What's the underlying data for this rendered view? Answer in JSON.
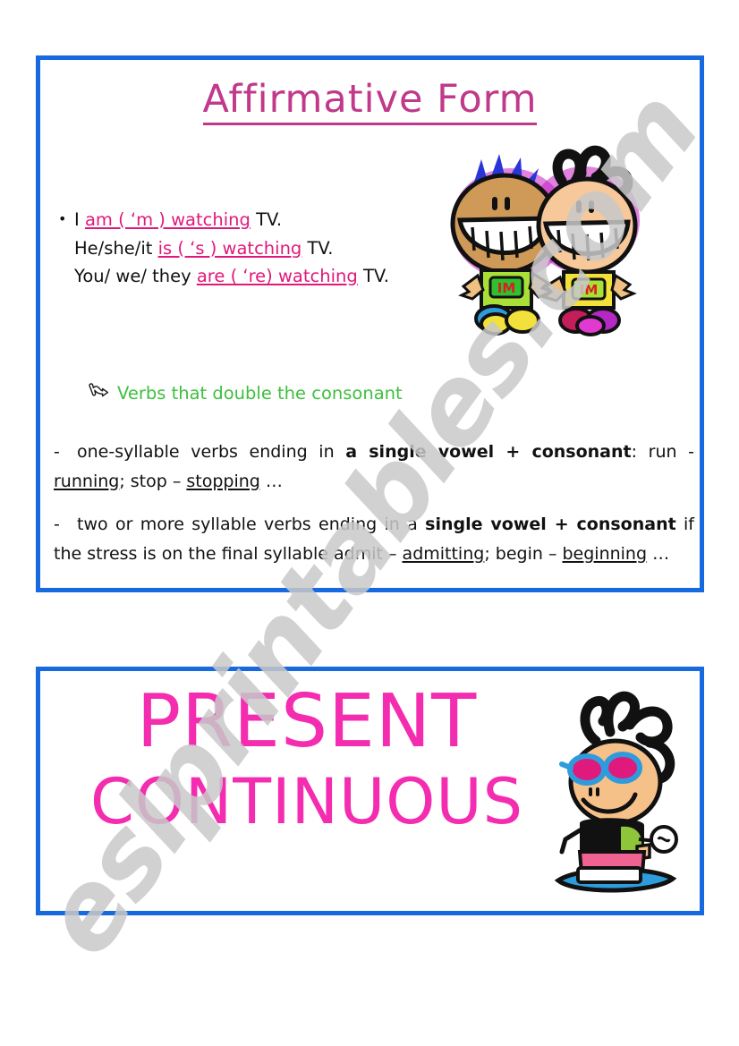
{
  "colors": {
    "border_blue": "#1769e0",
    "title_pink": "#c0398a",
    "highlight_pink": "#e0197c",
    "banner_pink": "#f42cb0",
    "green": "#3fbf3f",
    "text_black": "#111111",
    "watermark_gray": "#c9c9c9"
  },
  "watermark": {
    "text": "eslprintables.com"
  },
  "top_box": {
    "title": "Affirmative Form",
    "bullet_glyph": "•",
    "examples": [
      {
        "pre": "I ",
        "highlight": "am ( ‘m ) watching",
        "post": " TV."
      },
      {
        "pre": "He/she/it  ",
        "highlight": "is ( ‘s ) watching",
        "post": " TV."
      },
      {
        "pre": "You/ we/ they ",
        "highlight": "are ( ‘re) watching",
        "post": " TV."
      }
    ],
    "section_icon": "pointing-hand",
    "section_heading": "Verbs that double the consonant",
    "rules": [
      {
        "dash": "-",
        "parts": [
          {
            "text": "one-syllable verbs ending in ",
            "style": "normal"
          },
          {
            "text": "a single vowel + consonant",
            "style": "bold"
          },
          {
            "text": ": run - ",
            "style": "normal"
          },
          {
            "text": "running",
            "style": "underline"
          },
          {
            "text": "; stop – ",
            "style": "normal"
          },
          {
            "text": "stopping",
            "style": "underline"
          },
          {
            "text": " …",
            "style": "normal"
          }
        ]
      },
      {
        "dash": "-",
        "parts": [
          {
            "text": "two or more syllable verbs ending in a ",
            "style": "normal"
          },
          {
            "text": "single vowel + consonant",
            "style": "bold"
          },
          {
            "text": " if the stress is on the final syllable admit – ",
            "style": "normal"
          },
          {
            "text": "admitting",
            "style": "underline"
          },
          {
            "text": "; begin – ",
            "style": "normal"
          },
          {
            "text": "beginning",
            "style": "underline"
          },
          {
            "text": " …",
            "style": "normal"
          }
        ]
      }
    ],
    "illustration": {
      "name": "two-smiling-kids-clipart",
      "shirt_label": "IM",
      "kid_left": {
        "hair_color": "#2a35d8",
        "face_color": "#cf9a58",
        "shirt_color": "#a8e038"
      },
      "kid_right": {
        "hair_color": "#111111",
        "face_color": "#f6c89a",
        "shirt_color": "#f2e13a"
      }
    }
  },
  "bottom_box": {
    "line1": "PRESENT",
    "line2": "CONTINUOUS",
    "illustration": {
      "name": "skateboarding-kid-with-sunglasses-clipart",
      "hair_color": "#111111",
      "face_color": "#f6c089",
      "glasses_frame": "#2e9bdd",
      "glasses_lens": "#e0197c",
      "top_color": "#111111",
      "accent_color": "#8fc53a",
      "shorts_color": "#f06292",
      "shoes_color": "#2e9bdd"
    }
  }
}
